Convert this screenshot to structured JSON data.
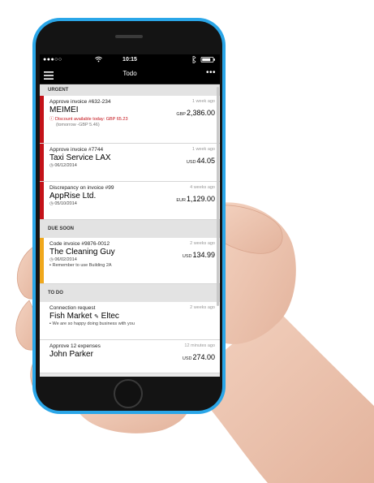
{
  "status": {
    "signal": "●●●○○",
    "time": "10:15"
  },
  "nav": {
    "title": "Todo"
  },
  "sections": [
    {
      "label": "URGENT",
      "items": [
        {
          "topline": "Approve invoice #632-234",
          "time": "1 week ago",
          "name": "MEIMEI",
          "currency": "GBP",
          "amount": "2,386.00",
          "meta1": "Discount available today: GBP 65.23",
          "meta2": "(tomorrow -GBP 5.46)"
        },
        {
          "topline": "Approve invoice #7744",
          "time": "1 week ago",
          "name": "Taxi Service LAX",
          "currency": "USD",
          "amount": "44.05",
          "meta1": "06/12/2014"
        },
        {
          "topline": "Discrepancy on invoice #99",
          "time": "4 weeks ago",
          "name": "AppRise Ltd.",
          "currency": "EUR",
          "amount": "1,129.00",
          "meta1": "05/10/2014"
        }
      ]
    },
    {
      "label": "DUE SOON",
      "items": [
        {
          "topline": "Code invoice #9876-0012",
          "time": "2 weeks ago",
          "name": "The Cleaning Guy",
          "currency": "USD",
          "amount": "134.99",
          "meta1": "06/02/2014",
          "meta2": "Remember to use Building 2A"
        }
      ]
    },
    {
      "label": "TO DO",
      "items": [
        {
          "topline": "Connection request",
          "time": "2 weeks ago",
          "name": "Fish Market",
          "name2": "Eltec",
          "meta1": "We are so happy doing business with you"
        },
        {
          "topline": "Approve 12 expenses",
          "time": "12 minutes ago",
          "name": "John Parker",
          "currency": "USD",
          "amount": "274.00"
        }
      ]
    }
  ],
  "colors": {
    "urgent": "#c41219",
    "due_soon": "#f0a81c",
    "phone": "#2aa6e8"
  },
  "icons": {
    "menu": "hamburger-menu-icon",
    "more": "more-dots-icon",
    "info": "info-icon",
    "clock": "clock-icon",
    "comment": "comment-icon",
    "link": "link-icon"
  }
}
